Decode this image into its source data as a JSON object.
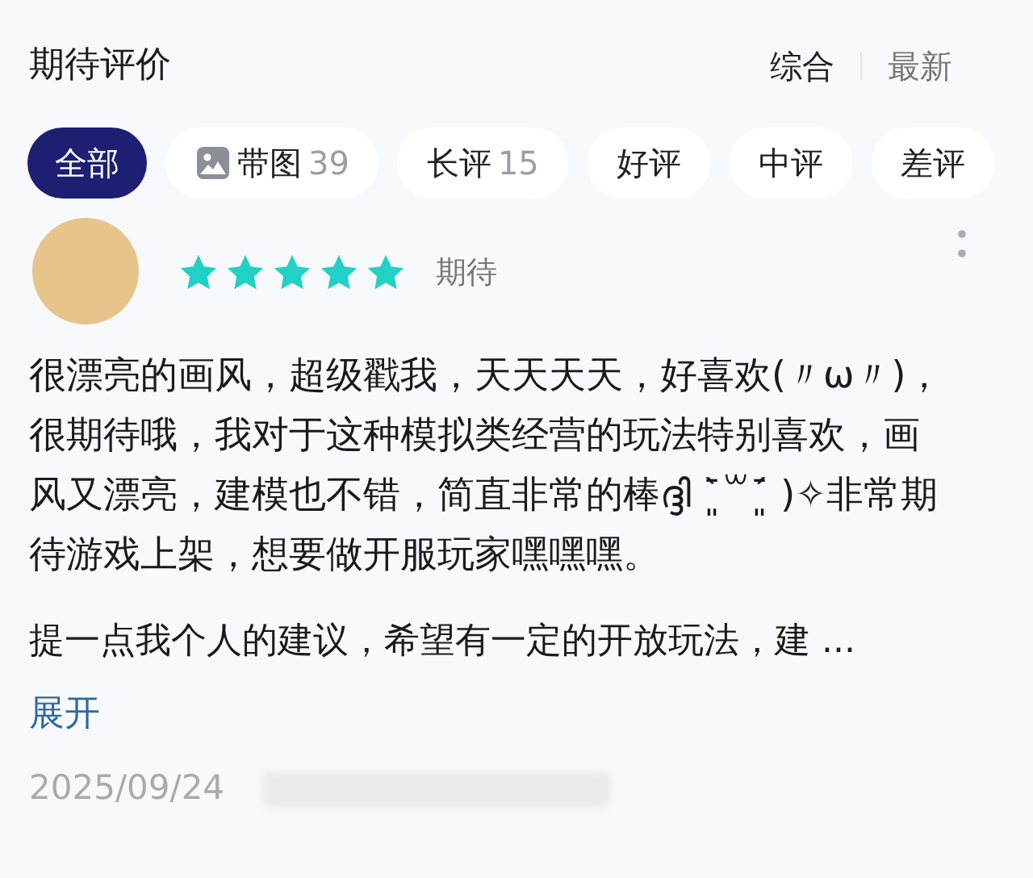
{
  "header": {
    "title": "期待评价",
    "sort_options": [
      {
        "label": "综合",
        "selected": true
      },
      {
        "label": "最新",
        "selected": false
      }
    ]
  },
  "filters": [
    {
      "label": "全部",
      "selected": true
    },
    {
      "label": "带图",
      "count": "39",
      "kind": "icon",
      "selected": false
    },
    {
      "label": "长评",
      "count": "15",
      "selected": false
    },
    {
      "label": "好评",
      "selected": false
    },
    {
      "label": "中评",
      "selected": false
    },
    {
      "label": "差评",
      "selected": false
    }
  ],
  "review": {
    "stars": 5,
    "tag": "期待",
    "paragraphs": [
      "很漂亮的画风，超级戳我，天天天天，好喜欢(〃ω〃)，很期待哦，我对于这种模拟类经营的玩法特别喜欢，画风又漂亮，建模也不错，简直非常的棒ദ്ദി ˉ͈̀꒳ˉ͈́ )✧非常期待游戏上架，想要做开服玩家嘿嘿嘿。"
    ],
    "truncated_line": "提一点我个人的建议，希望有一定的开放玩法，建 ...",
    "expand_link": "展开",
    "date": "2025/09/24"
  }
}
